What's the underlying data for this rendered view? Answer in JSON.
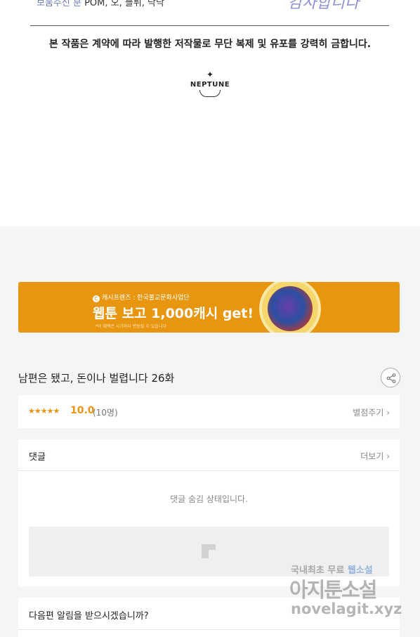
{
  "credits": {
    "label": "보움주신 분",
    "names": "POM, 오, 블뤼, 낙낙"
  },
  "signature": "감사합니다",
  "copyright_notice": "본 작품은 계약에 따라 발행한 저작물로 무단 복제 및 유포를 강력히 금합니다.",
  "publisher_logo": {
    "text": "NEPTUNE",
    "icon": "sparkle-icon"
  },
  "banner": {
    "sponsor": "캐시프렌즈 : 한국불교문화사업단",
    "headline": "웹툰 보고 1,000캐시 get!",
    "fine_print": "*이 혜택은 시기마다 변동될 수 있습니다",
    "accent": "#e8950f"
  },
  "episode": {
    "title": "남편은 됐고, 돈이나 벌렵니다 26화",
    "share_icon": "share-icon"
  },
  "rating": {
    "stars": "★★★★★",
    "score": "10.0",
    "count": "(10명)",
    "rate_link": "별점주기 ›",
    "color": "#e8950f"
  },
  "comments": {
    "label": "댓글",
    "more": "더보기 ›",
    "hidden_message": "댓글 숨김 상태입니다.",
    "input_icon": "comment-placeholder-icon"
  },
  "notify": {
    "question": "다음편 알림을 받으시겠습니까?"
  },
  "watermark": {
    "line1_a": "국내최초 무료 ",
    "line1_b": "웹소설",
    "line2": "아지툰소설",
    "line3": "novelagit.xyz"
  }
}
